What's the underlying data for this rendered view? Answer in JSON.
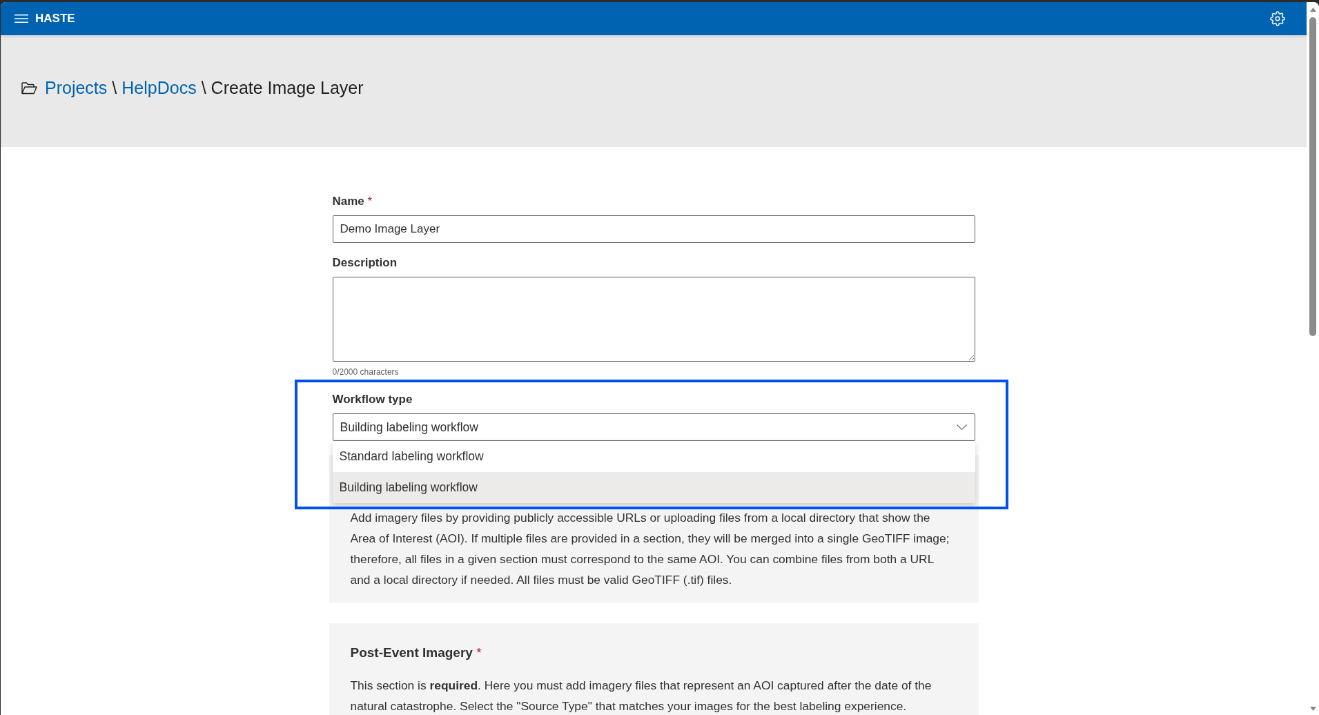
{
  "header": {
    "title": "HASTE"
  },
  "breadcrumb": [
    {
      "kind": "link",
      "label": "Projects"
    },
    {
      "kind": "separator",
      "label": "\\"
    },
    {
      "kind": "link",
      "label": "HelpDocs"
    },
    {
      "kind": "separator",
      "label": "\\"
    },
    {
      "kind": "current",
      "label": "Create Image Layer"
    }
  ],
  "form": {
    "fields": [
      {
        "kind": "text",
        "label": "Name",
        "required_mark": "*",
        "value": "Demo Image Layer"
      },
      {
        "kind": "textarea",
        "label": "Description",
        "counter": "0/2000 characters"
      },
      {
        "kind": "select",
        "label": "Workflow type",
        "value": "Building labeling workflow",
        "expanded": true,
        "highlighted": true,
        "options": [
          {
            "label": "Standard labeling workflow",
            "selected": false
          },
          {
            "label": "Building labeling workflow",
            "selected": true
          }
        ]
      }
    ]
  },
  "sections": [
    {
      "paragraph": "Add imagery files by providing publicly accessible URLs or uploading files from a local directory that show the Area of Interest (AOI). If multiple files are provided in a section, they will be merged into a single GeoTIFF image; therefore, all files in a given section must correspond to the same AOI. You can combine files from both a URL and a local directory if needed. All files must be valid GeoTIFF (.tif) files."
    },
    {
      "title": "Post-Event Imagery",
      "required_mark": "*",
      "paragraph": "This section is **required**. Here you must add imagery files that represent an AOI captured after the date of the natural catastrophe. Select the \"Source Type\" that matches your images for the best labeling experience."
    }
  ]
}
